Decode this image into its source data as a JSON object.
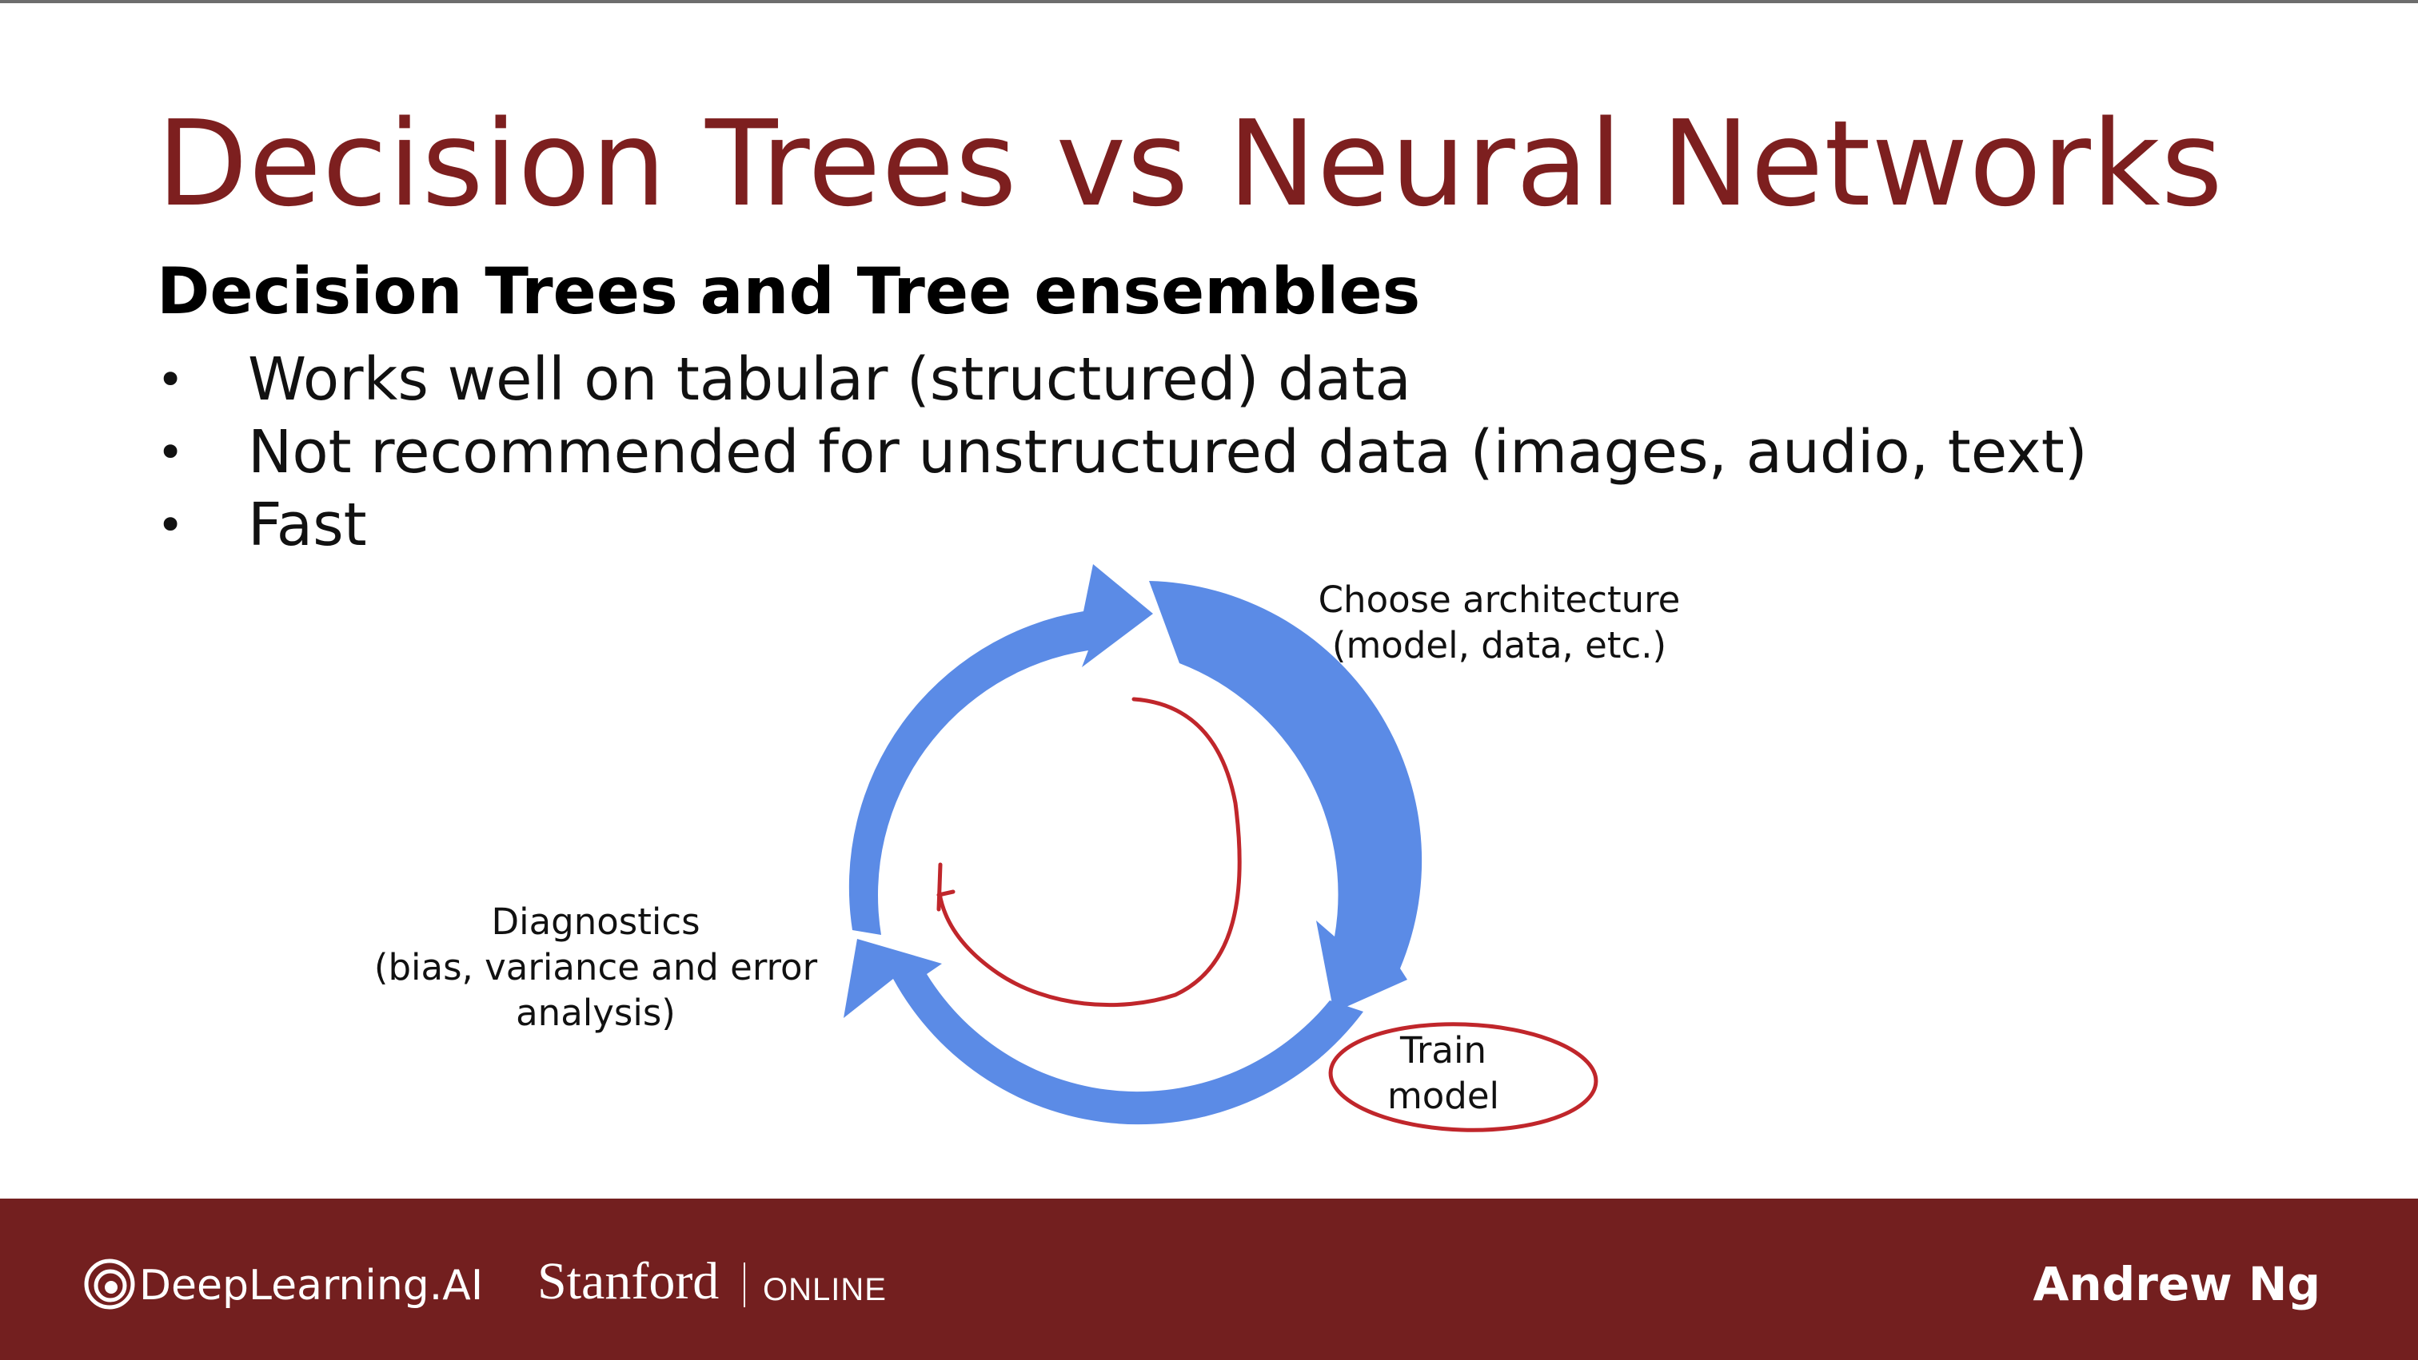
{
  "slide": {
    "title": "Decision Trees vs Neural Networks",
    "subtitle": "Decision Trees and Tree ensembles",
    "bullet_symbol": "•",
    "bullets": [
      "Works well on tabular (structured) data",
      "Not recommended for unstructured data (images, audio, text)",
      "Fast"
    ]
  },
  "diagram": {
    "choose_architecture": [
      "Choose architecture",
      "(model, data, etc.)"
    ],
    "diagnostics": [
      "Diagnostics",
      "(bias, variance and error",
      "analysis)"
    ],
    "train_model": [
      "Train",
      "model"
    ]
  },
  "footer": {
    "logo_text": "DeepLearning.AI",
    "partner_name": "Stanford",
    "partner_suffix": "ONLINE",
    "presenter": "Andrew Ng"
  },
  "colors": {
    "title": "#7d1f1f",
    "footer_bg": "#731f1f",
    "cycle_arrows": "#5b8be6",
    "ink_annotation": "#c0262b"
  }
}
